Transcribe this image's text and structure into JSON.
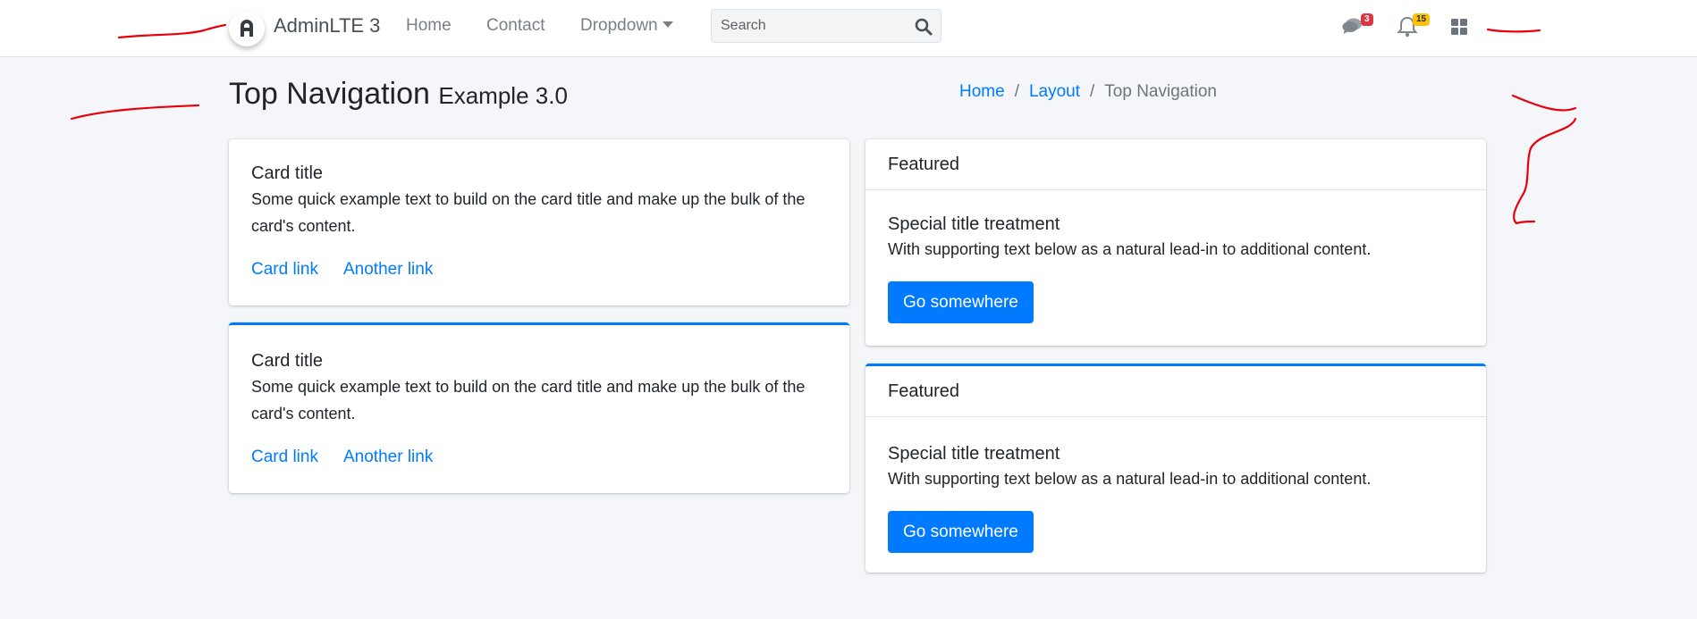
{
  "navbar": {
    "brand": "AdminLTE 3",
    "links": [
      "Home",
      "Contact",
      "Dropdown"
    ],
    "search_placeholder": "Search",
    "messages_count": "3",
    "notifications_count": "15"
  },
  "header": {
    "title": "Top Navigation",
    "subtitle": "Example 3.0",
    "breadcrumb": [
      "Home",
      "Layout",
      "Top Navigation"
    ]
  },
  "left_cards": [
    {
      "title": "Card title",
      "text": "Some quick example text to build on the card title and make up the bulk of the card's content.",
      "link1": "Card link",
      "link2": "Another link"
    },
    {
      "title": "Card title",
      "text": "Some quick example text to build on the card title and make up the bulk of the card's content.",
      "link1": "Card link",
      "link2": "Another link"
    }
  ],
  "right_cards": [
    {
      "header": "Featured",
      "title": "Special title treatment",
      "text": "With supporting text below as a natural lead-in to additional content.",
      "button": "Go somewhere"
    },
    {
      "header": "Featured",
      "title": "Special title treatment",
      "text": "With supporting text below as a natural lead-in to additional content.",
      "button": "Go somewhere"
    }
  ],
  "colors": {
    "primary": "#007bff",
    "background": "#f4f6f9",
    "badge_danger": "#dc3545",
    "badge_warning": "#ffc107",
    "annotation": "#e8000b"
  },
  "icons": [
    "adminlte-logo-icon",
    "search-icon",
    "comments-icon",
    "bell-icon",
    "th-large-icon"
  ]
}
